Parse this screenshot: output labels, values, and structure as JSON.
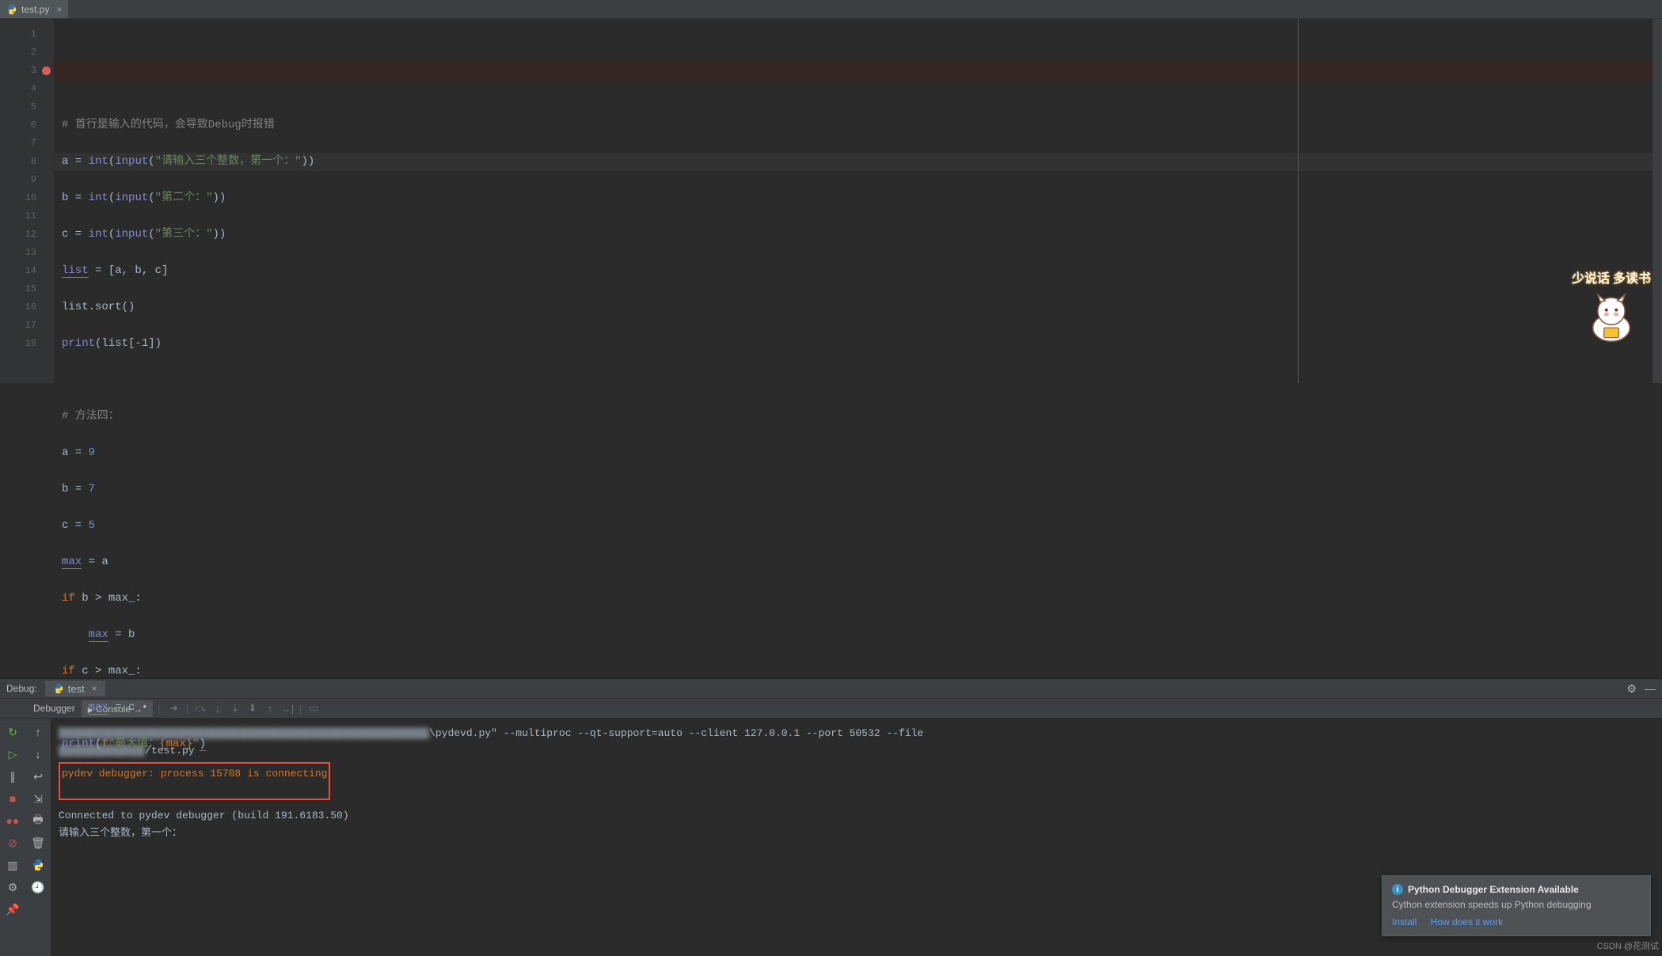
{
  "tab": {
    "filename": "test.py"
  },
  "editor": {
    "breakpoint_line": 3,
    "caret_line": 8,
    "lines": {
      "l1_comment": "# 首行是输入的代码，会导致Debug时报错",
      "l2_a": "a",
      "l2_eq": " = ",
      "l2_int": "int",
      "l2_input": "input",
      "l2_str": "\"请输入三个整数，第一个：\"",
      "l3_a": "b",
      "l3_int": "int",
      "l3_input": "input",
      "l3_str": "\"第二个：\"",
      "l4_a": "c",
      "l4_int": "int",
      "l4_input": "input",
      "l4_str": "\"第三个：\"",
      "l5_list": "list",
      "l5_rest": " = [a, b, c]",
      "l6": "list.sort()",
      "l7_print": "print",
      "l7_rest": "(list[-1])",
      "l9": "# 方法四：",
      "l10_a": "a = ",
      "l10_n": "9",
      "l11_a": "b = ",
      "l11_n": "7",
      "l12_a": "c = ",
      "l12_n": "5",
      "l13_max": "max",
      "l13_rest": " = a",
      "l14_if": "if ",
      "l14_cond": "b > max_:",
      "l15_max": "max",
      "l15_rest": " = b",
      "l16_if": "if ",
      "l16_cond": "c > max_:",
      "l17_max": "max",
      "l17_rest": " = c",
      "l18_print": "print",
      "l18_f": "f",
      "l18_str1": "\"最大值：",
      "l18_brace": "{max}",
      "l18_str2": "\"",
      "l18_close": ")"
    }
  },
  "debug": {
    "label": "Debug:",
    "config": "test",
    "tab_debugger": "Debugger",
    "tab_console": "Console"
  },
  "console": {
    "cmd_tail": "\\pydevd.py\" --multiproc --qt-support=auto --client 127.0.0.1 --port 50532 --file",
    "path_tail": "/test.py",
    "connecting": "pydev debugger: process 15708 is connecting",
    "connected": "Connected to pydev debugger (build 191.6183.50)",
    "prompt": "请输入三个整数，第一个："
  },
  "notif": {
    "title": "Python Debugger Extension Available",
    "body": "Cython extension speeds up Python debugging",
    "install": "Install",
    "howto": "How does it work"
  },
  "watermark": {
    "caption": "少说话 多读书",
    "csdn": "CSDN @花测试"
  }
}
